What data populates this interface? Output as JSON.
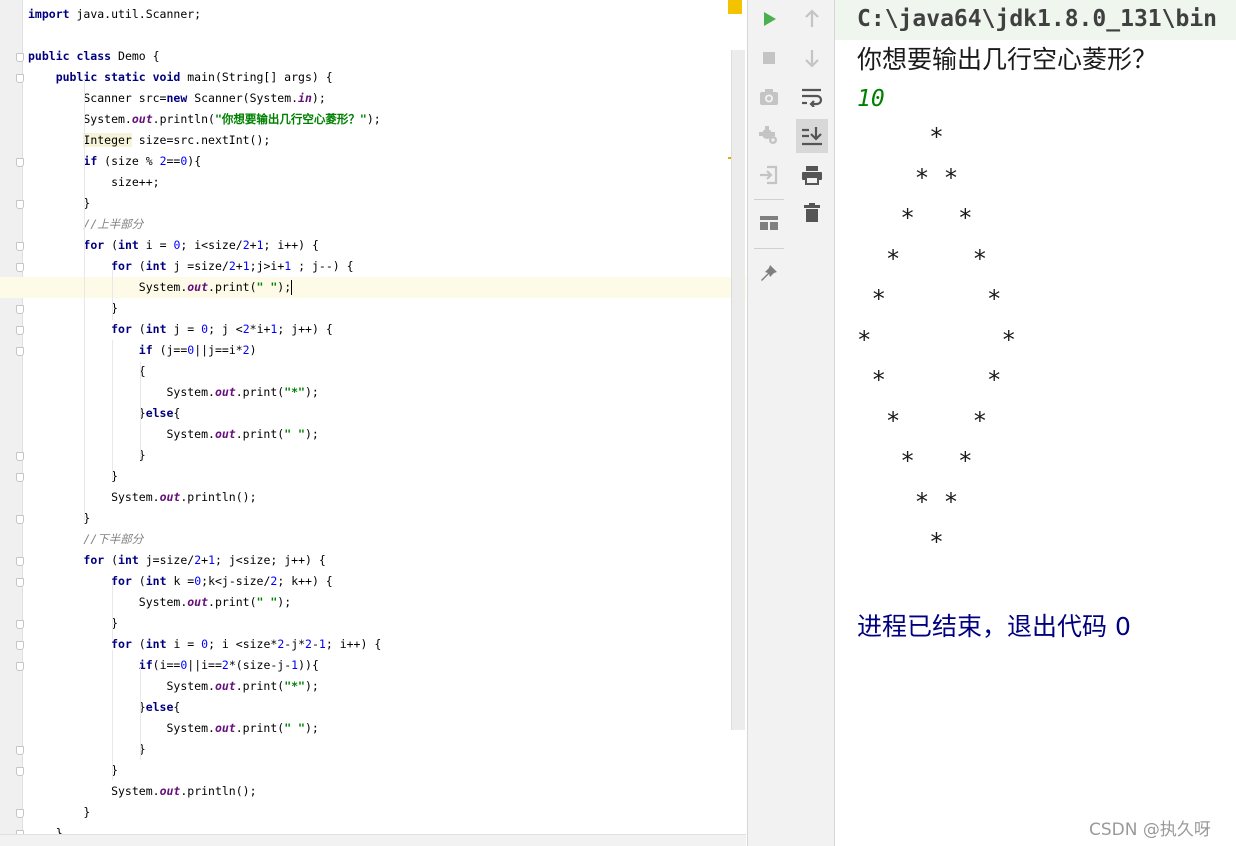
{
  "editor": {
    "lines": [
      {
        "parts": [
          {
            "t": "import",
            "c": "kw"
          },
          {
            "t": " java.util.Scanner;"
          }
        ]
      },
      {
        "parts": []
      },
      {
        "fold": true,
        "parts": [
          {
            "t": "public class",
            "c": "kw"
          },
          {
            "t": " Demo {"
          }
        ]
      },
      {
        "fold": true,
        "parts": [
          {
            "t": "    "
          },
          {
            "t": "public static void",
            "c": "kw"
          },
          {
            "t": " main(String[] args) {"
          }
        ]
      },
      {
        "parts": [
          {
            "t": "        Scanner src="
          },
          {
            "t": "new",
            "c": "kw"
          },
          {
            "t": " Scanner(System."
          },
          {
            "t": "in",
            "c": "fld"
          },
          {
            "t": ");"
          }
        ]
      },
      {
        "parts": [
          {
            "t": "        System."
          },
          {
            "t": "out",
            "c": "fld"
          },
          {
            "t": ".println("
          },
          {
            "t": "\"你想要输出几行空心菱形？\"",
            "c": "str"
          },
          {
            "t": ");"
          }
        ]
      },
      {
        "parts": [
          {
            "t": "        "
          },
          {
            "t": "Integer",
            "c": "hl-type"
          },
          {
            "t": " size=src.nextInt();"
          }
        ]
      },
      {
        "fold": true,
        "parts": [
          {
            "t": "        "
          },
          {
            "t": "if",
            "c": "kw"
          },
          {
            "t": " (size % "
          },
          {
            "t": "2",
            "c": "num"
          },
          {
            "t": "=="
          },
          {
            "t": "0",
            "c": "num"
          },
          {
            "t": "){"
          }
        ]
      },
      {
        "parts": [
          {
            "t": "            size++;"
          }
        ]
      },
      {
        "fold": true,
        "parts": [
          {
            "t": "        }"
          }
        ]
      },
      {
        "parts": [
          {
            "t": "        "
          },
          {
            "t": "//上半部分",
            "c": "cmt"
          }
        ]
      },
      {
        "fold": true,
        "parts": [
          {
            "t": "        "
          },
          {
            "t": "for",
            "c": "kw"
          },
          {
            "t": " ("
          },
          {
            "t": "int",
            "c": "kw"
          },
          {
            "t": " i = "
          },
          {
            "t": "0",
            "c": "num"
          },
          {
            "t": "; i<size/"
          },
          {
            "t": "2",
            "c": "num"
          },
          {
            "t": "+"
          },
          {
            "t": "1",
            "c": "num"
          },
          {
            "t": "; i++) {"
          }
        ]
      },
      {
        "fold": true,
        "parts": [
          {
            "t": "            "
          },
          {
            "t": "for",
            "c": "kw"
          },
          {
            "t": " ("
          },
          {
            "t": "int",
            "c": "kw"
          },
          {
            "t": " j =size/"
          },
          {
            "t": "2",
            "c": "num"
          },
          {
            "t": "+"
          },
          {
            "t": "1",
            "c": "num"
          },
          {
            "t": ";j>i+"
          },
          {
            "t": "1",
            "c": "num"
          },
          {
            "t": " ; j--) {"
          }
        ]
      },
      {
        "caret": true,
        "parts": [
          {
            "t": "                System."
          },
          {
            "t": "out",
            "c": "fld"
          },
          {
            "t": ".print("
          },
          {
            "t": "\" \"",
            "c": "str"
          },
          {
            "t": ");"
          }
        ]
      },
      {
        "fold": true,
        "parts": [
          {
            "t": "            }"
          }
        ]
      },
      {
        "fold": true,
        "parts": [
          {
            "t": "            "
          },
          {
            "t": "for",
            "c": "kw"
          },
          {
            "t": " ("
          },
          {
            "t": "int",
            "c": "kw"
          },
          {
            "t": " j = "
          },
          {
            "t": "0",
            "c": "num"
          },
          {
            "t": "; j <"
          },
          {
            "t": "2",
            "c": "num"
          },
          {
            "t": "*i+"
          },
          {
            "t": "1",
            "c": "num"
          },
          {
            "t": "; j++) {"
          }
        ]
      },
      {
        "fold": true,
        "parts": [
          {
            "t": "                "
          },
          {
            "t": "if",
            "c": "kw"
          },
          {
            "t": " (j=="
          },
          {
            "t": "0",
            "c": "num"
          },
          {
            "t": "||j==i*"
          },
          {
            "t": "2",
            "c": "num"
          },
          {
            "t": ")"
          }
        ]
      },
      {
        "parts": [
          {
            "t": "                {"
          }
        ]
      },
      {
        "parts": [
          {
            "t": "                    System."
          },
          {
            "t": "out",
            "c": "fld"
          },
          {
            "t": ".print("
          },
          {
            "t": "\"*\"",
            "c": "str"
          },
          {
            "t": ");"
          }
        ]
      },
      {
        "parts": [
          {
            "t": "                }"
          },
          {
            "t": "else",
            "c": "kw"
          },
          {
            "t": "{"
          }
        ]
      },
      {
        "parts": [
          {
            "t": "                    System."
          },
          {
            "t": "out",
            "c": "fld"
          },
          {
            "t": ".print("
          },
          {
            "t": "\" \"",
            "c": "str"
          },
          {
            "t": ");"
          }
        ]
      },
      {
        "fold": true,
        "parts": [
          {
            "t": "                }"
          }
        ]
      },
      {
        "fold": true,
        "parts": [
          {
            "t": "            }"
          }
        ]
      },
      {
        "parts": [
          {
            "t": "            System."
          },
          {
            "t": "out",
            "c": "fld"
          },
          {
            "t": ".println();"
          }
        ]
      },
      {
        "fold": true,
        "parts": [
          {
            "t": "        }"
          }
        ]
      },
      {
        "parts": [
          {
            "t": "        "
          },
          {
            "t": "//下半部分",
            "c": "cmt"
          }
        ]
      },
      {
        "fold": true,
        "parts": [
          {
            "t": "        "
          },
          {
            "t": "for",
            "c": "kw"
          },
          {
            "t": " ("
          },
          {
            "t": "int",
            "c": "kw"
          },
          {
            "t": " j=size/"
          },
          {
            "t": "2",
            "c": "num"
          },
          {
            "t": "+"
          },
          {
            "t": "1",
            "c": "num"
          },
          {
            "t": "; j<size; j++) {"
          }
        ]
      },
      {
        "fold": true,
        "parts": [
          {
            "t": "            "
          },
          {
            "t": "for",
            "c": "kw"
          },
          {
            "t": " ("
          },
          {
            "t": "int",
            "c": "kw"
          },
          {
            "t": " k ="
          },
          {
            "t": "0",
            "c": "num"
          },
          {
            "t": ";k<j-size/"
          },
          {
            "t": "2",
            "c": "num"
          },
          {
            "t": "; k++) {"
          }
        ]
      },
      {
        "parts": [
          {
            "t": "                System."
          },
          {
            "t": "out",
            "c": "fld"
          },
          {
            "t": ".print("
          },
          {
            "t": "\" \"",
            "c": "str"
          },
          {
            "t": ");"
          }
        ]
      },
      {
        "fold": true,
        "parts": [
          {
            "t": "            }"
          }
        ]
      },
      {
        "fold": true,
        "parts": [
          {
            "t": "            "
          },
          {
            "t": "for",
            "c": "kw"
          },
          {
            "t": " ("
          },
          {
            "t": "int",
            "c": "kw"
          },
          {
            "t": " i = "
          },
          {
            "t": "0",
            "c": "num"
          },
          {
            "t": "; i <size*"
          },
          {
            "t": "2",
            "c": "num"
          },
          {
            "t": "-j*"
          },
          {
            "t": "2",
            "c": "num"
          },
          {
            "t": "-"
          },
          {
            "t": "1",
            "c": "num"
          },
          {
            "t": "; i++) {"
          }
        ]
      },
      {
        "fold": true,
        "parts": [
          {
            "t": "                "
          },
          {
            "t": "if",
            "c": "kw"
          },
          {
            "t": "(i=="
          },
          {
            "t": "0",
            "c": "num"
          },
          {
            "t": "||i=="
          },
          {
            "t": "2",
            "c": "num"
          },
          {
            "t": "*(size-j-"
          },
          {
            "t": "1",
            "c": "num"
          },
          {
            "t": ")){"
          }
        ]
      },
      {
        "parts": [
          {
            "t": "                    System."
          },
          {
            "t": "out",
            "c": "fld"
          },
          {
            "t": ".print("
          },
          {
            "t": "\"*\"",
            "c": "str"
          },
          {
            "t": ");"
          }
        ]
      },
      {
        "parts": [
          {
            "t": "                }"
          },
          {
            "t": "else",
            "c": "kw"
          },
          {
            "t": "{"
          }
        ]
      },
      {
        "parts": [
          {
            "t": "                    System."
          },
          {
            "t": "out",
            "c": "fld"
          },
          {
            "t": ".print("
          },
          {
            "t": "\" \"",
            "c": "str"
          },
          {
            "t": ");"
          }
        ]
      },
      {
        "fold": true,
        "parts": [
          {
            "t": "                }"
          }
        ]
      },
      {
        "fold": true,
        "parts": [
          {
            "t": "            }"
          }
        ]
      },
      {
        "parts": [
          {
            "t": "            System."
          },
          {
            "t": "out",
            "c": "fld"
          },
          {
            "t": ".println();"
          }
        ]
      },
      {
        "fold": true,
        "parts": [
          {
            "t": "        }"
          }
        ]
      },
      {
        "fold": true,
        "parts": [
          {
            "t": "    }"
          }
        ]
      }
    ]
  },
  "toolbar_left": [
    "run-icon",
    "stop-icon",
    "camera-icon",
    "debug-settings-icon",
    "login-icon",
    "layout-icon",
    "pin-icon"
  ],
  "toolbar_right": [
    "arrow-up-icon",
    "arrow-down-icon",
    "soft-wrap-icon",
    "scroll-to-end-icon",
    "print-icon",
    "trash-icon"
  ],
  "console": {
    "command": "C:\\java64\\jdk1.8.0_131\\bin",
    "prompt": "你想要输出几行空心菱形？",
    "input": "10",
    "output": [
      "     *",
      "    * *",
      "   *   *",
      "  *     *",
      " *       *",
      "*         *",
      " *       *",
      "  *     *",
      "   *   *",
      "    * *",
      "     *"
    ],
    "exit": "进程已结束，退出代码 0",
    "watermark": "CSDN @执久呀"
  },
  "colors": {
    "keyword": "#000080",
    "string": "#008000",
    "number": "#0000ff",
    "field": "#660e7a",
    "comment": "#808080",
    "console_input": "#008000",
    "console_exit": "#000080",
    "run_green": "#4caf50"
  }
}
